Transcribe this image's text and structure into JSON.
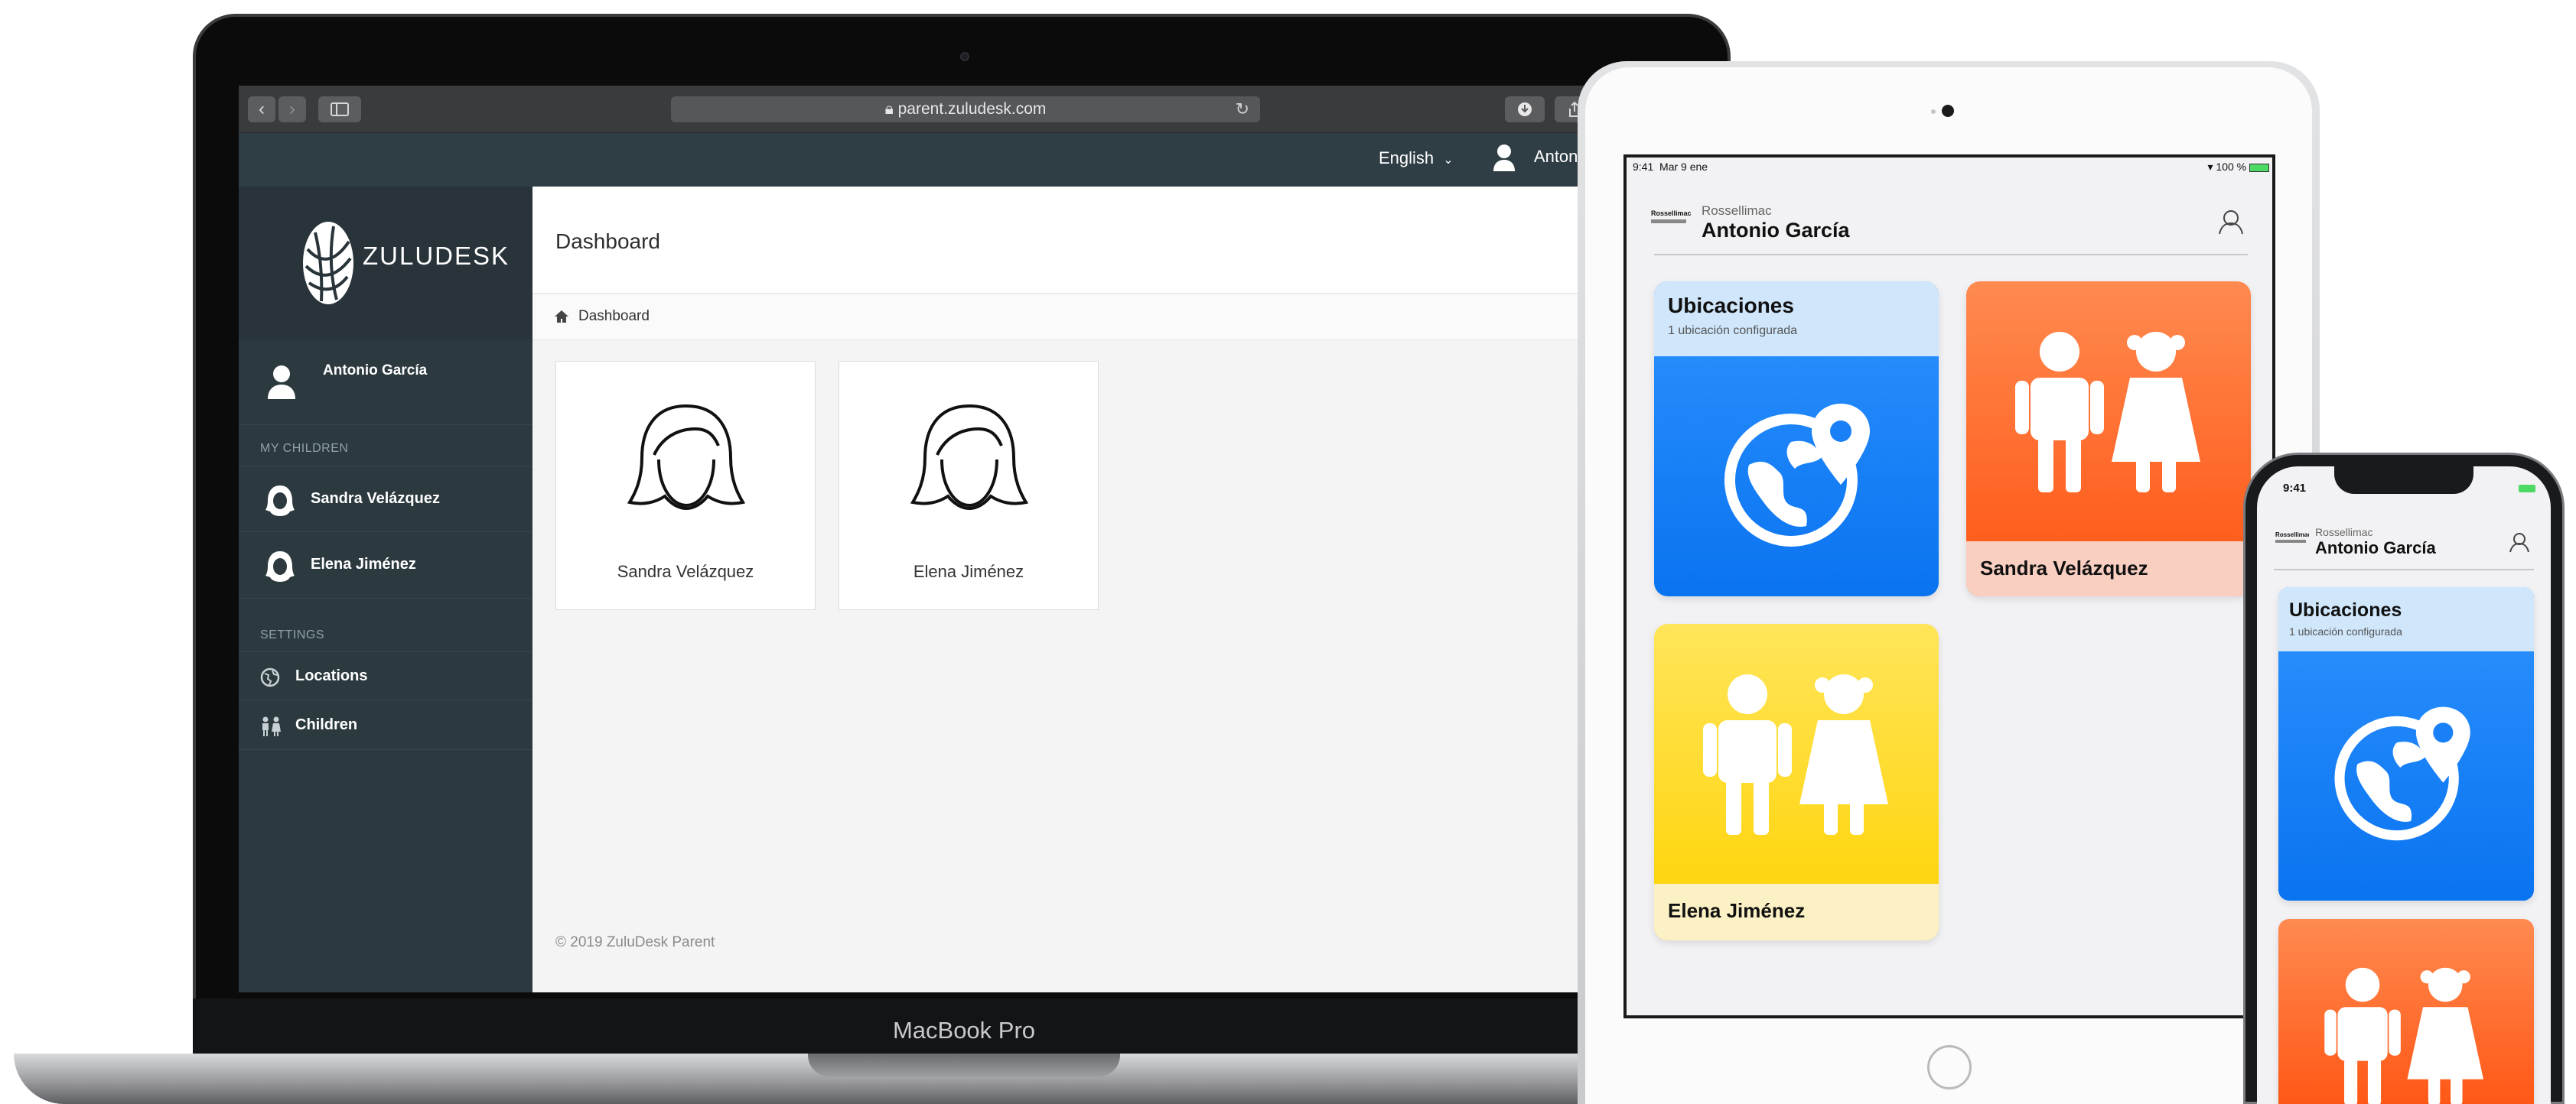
{
  "macbook": {
    "label": "MacBook Pro",
    "safari": {
      "url": "parent.zuludesk.com",
      "back_glyph": "‹",
      "forward_glyph": "›"
    },
    "app": {
      "language": "English",
      "top_user": "Antonio",
      "logo_text": "ZULUDESK",
      "sidebar": {
        "user_name": "Antonio García",
        "children_heading": "MY CHILDREN",
        "children": [
          {
            "label": "Sandra Velázquez"
          },
          {
            "label": "Elena Jiménez"
          }
        ],
        "settings_heading": "SETTINGS",
        "settings": [
          {
            "label": "Locations",
            "icon": "globe-icon"
          },
          {
            "label": "Children",
            "icon": "children-icon"
          }
        ]
      },
      "page_title": "Dashboard",
      "breadcrumb": "Dashboard",
      "cards": [
        {
          "name": "Sandra Velázquez"
        },
        {
          "name": "Elena Jiménez"
        }
      ],
      "footer": "© 2019 ZuluDesk Parent"
    }
  },
  "ipad": {
    "status_time": "9:41",
    "status_date": "Mar 9 ene",
    "battery": "100 %",
    "org": "Rossellimac",
    "user": "Antonio García",
    "tiles": [
      {
        "title": "Ubicaciones",
        "subtitle": "1 ubicación configurada",
        "color": "#1a80f7"
      },
      {
        "title": "Sandra Velázquez",
        "color": "#ff6a33"
      },
      {
        "title": "Elena Jiménez",
        "color": "#ffd51f"
      }
    ]
  },
  "iphone": {
    "status_time": "9:41",
    "org": "Rossellimac",
    "user": "Antonio García",
    "tile_title": "Ubicaciones",
    "tile_subtitle": "1 ubicación configurada"
  },
  "colors": {
    "sidebar": "#2c393f",
    "topbar": "#2f3d44",
    "blue_tile": "#1a80f7",
    "orange_tile": "#ff6a33",
    "yellow_tile": "#ffd51f"
  }
}
